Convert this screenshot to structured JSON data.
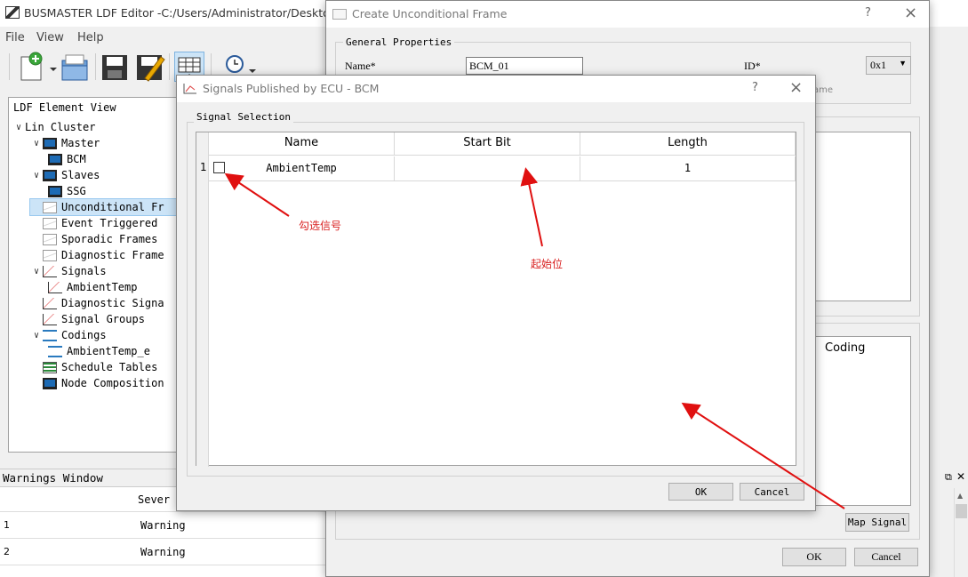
{
  "main_window": {
    "title": "BUSMASTER LDF Editor -C:/Users/Administrator/Desktop/",
    "menu": [
      "File",
      "View",
      "Help"
    ]
  },
  "tree": {
    "header": "LDF Element View",
    "items": [
      {
        "label": "Lin Cluster",
        "icon": "none",
        "expand": "v"
      },
      {
        "label": "Master",
        "icon": "monitor-icon",
        "expand": "v"
      },
      {
        "label": "BCM",
        "icon": "monitor-icon",
        "expand": ""
      },
      {
        "label": "Slaves",
        "icon": "monitor-icon",
        "expand": "v"
      },
      {
        "label": "SSG",
        "icon": "monitor-icon",
        "expand": ""
      },
      {
        "label": "Unconditional Fr",
        "icon": "envelope-icon",
        "expand": ""
      },
      {
        "label": "Event Triggered",
        "icon": "envelope-icon",
        "expand": ""
      },
      {
        "label": "Sporadic Frames",
        "icon": "envelope-icon",
        "expand": ""
      },
      {
        "label": "Diagnostic Frame",
        "icon": "envelope-icon",
        "expand": ""
      },
      {
        "label": "Signals",
        "icon": "graph-icon",
        "expand": "v"
      },
      {
        "label": "AmbientTemp",
        "icon": "graph-icon",
        "expand": ""
      },
      {
        "label": "Diagnostic Signa",
        "icon": "graph-icon",
        "expand": ""
      },
      {
        "label": "Signal Groups",
        "icon": "graph-icon",
        "expand": ""
      },
      {
        "label": "Codings",
        "icon": "coding-icon",
        "expand": "v"
      },
      {
        "label": "AmbientTemp_e",
        "icon": "coding-icon",
        "expand": ""
      },
      {
        "label": "Schedule Tables",
        "icon": "schedule-icon",
        "expand": ""
      },
      {
        "label": "Node Composition",
        "icon": "monitor-icon",
        "expand": ""
      }
    ]
  },
  "warnings": {
    "title": "Warnings Window",
    "column": "Sever",
    "rows": [
      {
        "num": "1",
        "value": "Warning"
      },
      {
        "num": "2",
        "value": "Warning"
      }
    ]
  },
  "frame_dialog": {
    "title": "Create Unconditional Frame",
    "help": "?",
    "close": "×",
    "group_label": "General Properties",
    "name_label": "Name*",
    "name_value": "BCM_01",
    "id_label": "ID*",
    "id_value": "0x1",
    "partial_text": "ame",
    "coding_header": "Coding",
    "map_signal": "Map Signal",
    "ok": "OK",
    "cancel": "Cancel"
  },
  "signals_dialog": {
    "title": "Signals Published by ECU - BCM",
    "help": "?",
    "close": "×",
    "group_label": "Signal Selection",
    "columns": [
      "Name",
      "Start Bit",
      "Length"
    ],
    "rows": [
      {
        "num": "1",
        "name": "AmbientTemp",
        "start_bit": "",
        "length": "1"
      }
    ],
    "ok": "OK",
    "cancel": "Cancel"
  },
  "annotations": {
    "check": "勾选信号",
    "start": "起始位"
  },
  "colors": {
    "annotation": "#d81e1e",
    "selection": "#cce4f7"
  }
}
